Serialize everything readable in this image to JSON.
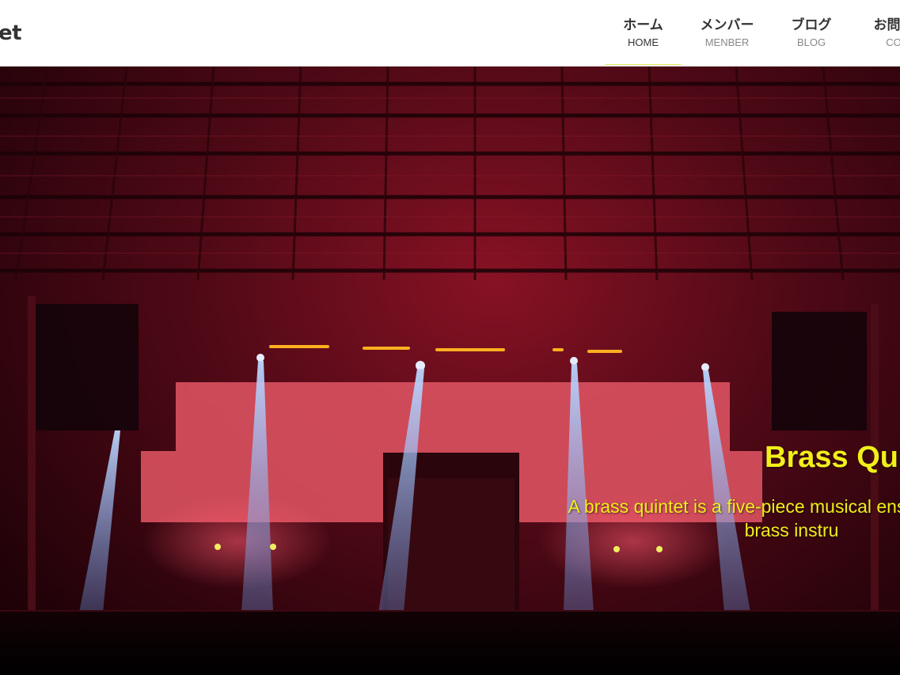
{
  "header": {
    "logo_text": "et",
    "nav": [
      {
        "jp": "ホーム",
        "en": "HOME",
        "active": true
      },
      {
        "jp": "メンバー",
        "en": "MENBER",
        "active": false
      },
      {
        "jp": "ブログ",
        "en": "BLOG",
        "active": false
      },
      {
        "jp": "お問い",
        "en": "CO",
        "active": false
      }
    ]
  },
  "hero": {
    "title": "Brass Qui",
    "description": "A brass quintet is a five-piece musical ens composed of brass instru"
  },
  "colors": {
    "accent_yellow": "#f2ee1a",
    "nav_underline": "#e8e85c",
    "stage_red": "#c0334a"
  }
}
